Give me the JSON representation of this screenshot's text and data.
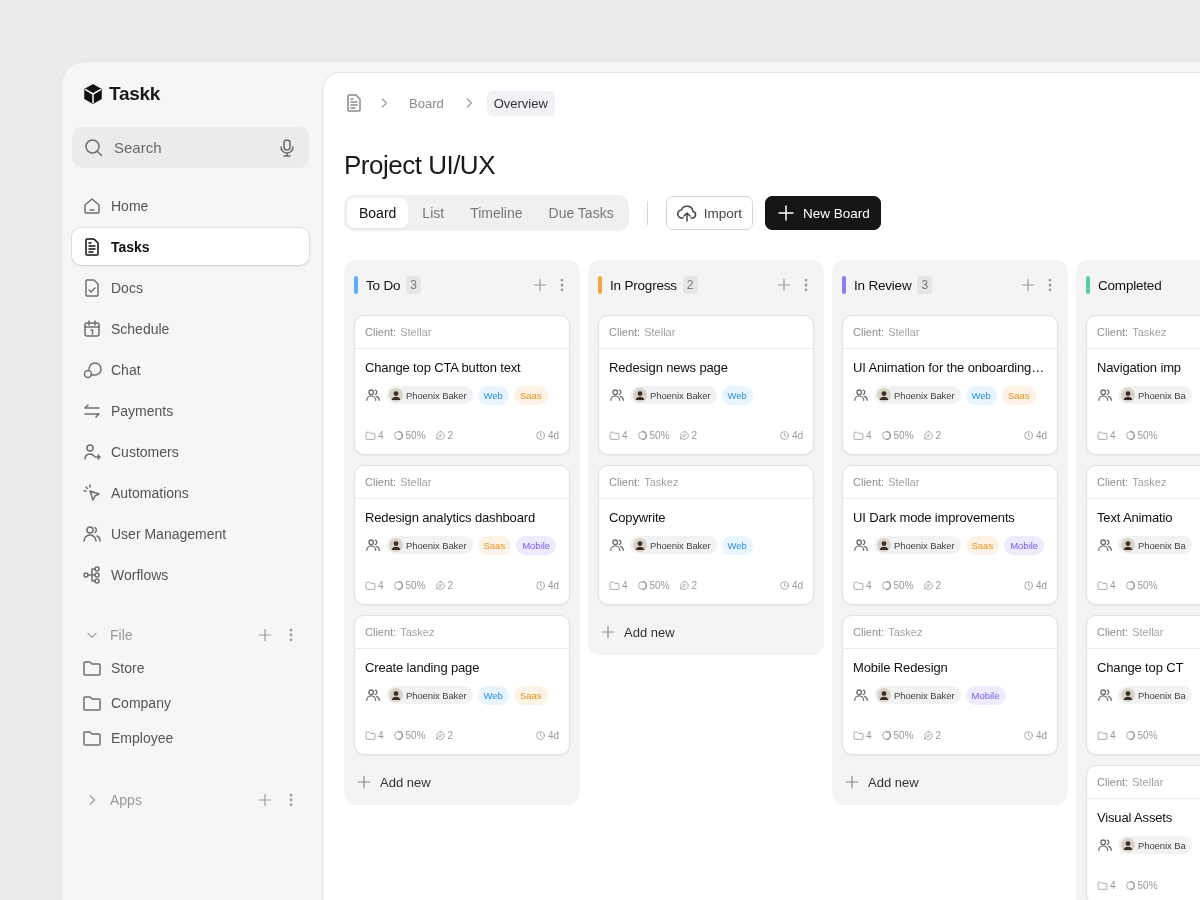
{
  "app": {
    "name": "Taskk"
  },
  "search": {
    "placeholder": "Search"
  },
  "nav": [
    {
      "label": "Home",
      "selected": false
    },
    {
      "label": "Tasks",
      "selected": true
    },
    {
      "label": "Docs",
      "selected": false
    },
    {
      "label": "Schedule",
      "selected": false
    },
    {
      "label": "Chat",
      "selected": false
    },
    {
      "label": "Payments",
      "selected": false
    },
    {
      "label": "Customers",
      "selected": false
    },
    {
      "label": "Automations",
      "selected": false
    },
    {
      "label": "User Management",
      "selected": false
    },
    {
      "label": "Worflows",
      "selected": false
    }
  ],
  "sections": [
    {
      "title": "File",
      "expanded": true,
      "items": [
        {
          "label": "Store"
        },
        {
          "label": "Company"
        },
        {
          "label": "Employee"
        }
      ]
    },
    {
      "title": "Apps",
      "expanded": false
    }
  ],
  "breadcrumb": [
    {
      "label": "Board",
      "current": false
    },
    {
      "label": "Overview",
      "current": true
    }
  ],
  "page_title": "Project UI/UX",
  "view_tabs": [
    {
      "label": "Board",
      "selected": true
    },
    {
      "label": "List",
      "selected": false
    },
    {
      "label": "Timeline",
      "selected": false
    },
    {
      "label": "Due Tasks",
      "selected": false
    }
  ],
  "actions": [
    {
      "label": "Import",
      "kind": "secondary"
    },
    {
      "label": "New Board",
      "kind": "primary"
    }
  ],
  "columns": [
    {
      "title": "To Do",
      "count": "3",
      "color": "#5aaefc",
      "add_new": "Add new",
      "cards": [
        {
          "client_label": "Client:",
          "client": "Stellar",
          "title": "Change top CTA button text",
          "assignee": "Phoenix Baker",
          "tags": [
            {
              "label": "Web",
              "kind": "web"
            },
            {
              "label": "Saas",
              "kind": "saas"
            }
          ],
          "files": "4",
          "progress": "50%",
          "comments": "2",
          "due": "4d"
        },
        {
          "client_label": "Client:",
          "client": "Stellar",
          "title": "Redesign analytics dashboard",
          "assignee": "Phoenix Baker",
          "tags": [
            {
              "label": "Saas",
              "kind": "saas"
            },
            {
              "label": "Mobile",
              "kind": "mobile"
            }
          ],
          "files": "4",
          "progress": "50%",
          "comments": "2",
          "due": "4d"
        },
        {
          "client_label": "Client:",
          "client": "Taskez",
          "title": "Create landing page",
          "assignee": "Phoenix Baker",
          "tags": [
            {
              "label": "Web",
              "kind": "web"
            },
            {
              "label": "Saas",
              "kind": "saas"
            }
          ],
          "files": "4",
          "progress": "50%",
          "comments": "2",
          "due": "4d"
        }
      ]
    },
    {
      "title": "In Progress",
      "count": "2",
      "color": "#f5a742",
      "add_new": "Add new",
      "cards": [
        {
          "client_label": "Client:",
          "client": "Stellar",
          "title": "Redesign news page",
          "assignee": "Phoenix Baker",
          "tags": [
            {
              "label": "Web",
              "kind": "web"
            }
          ],
          "files": "4",
          "progress": "50%",
          "comments": "2",
          "due": "4d"
        },
        {
          "client_label": "Client:",
          "client": "Taskez",
          "title": "Copywrite",
          "assignee": "Phoenix Baker",
          "tags": [
            {
              "label": "Web",
              "kind": "web"
            }
          ],
          "files": "4",
          "progress": "50%",
          "comments": "2",
          "due": "4d"
        }
      ]
    },
    {
      "title": "In Review",
      "count": "3",
      "color": "#8b7cf6",
      "add_new": "Add new",
      "cards": [
        {
          "client_label": "Client:",
          "client": "Stellar",
          "title": "UI Animation for the onboarding…",
          "assignee": "Phoenix Baker",
          "tags": [
            {
              "label": "Web",
              "kind": "web"
            },
            {
              "label": "Saas",
              "kind": "saas"
            }
          ],
          "files": "4",
          "progress": "50%",
          "comments": "2",
          "due": "4d"
        },
        {
          "client_label": "Client:",
          "client": "Stellar",
          "title": "UI Dark mode improvements",
          "assignee": "Phoenix Baker",
          "tags": [
            {
              "label": "Saas",
              "kind": "saas"
            },
            {
              "label": "Mobile",
              "kind": "mobile"
            }
          ],
          "files": "4",
          "progress": "50%",
          "comments": "2",
          "due": "4d"
        },
        {
          "client_label": "Client:",
          "client": "Taskez",
          "title": "Mobile Redesign",
          "assignee": "Phoenix Baker",
          "tags": [
            {
              "label": "Mobile",
              "kind": "mobile"
            }
          ],
          "files": "4",
          "progress": "50%",
          "comments": "2",
          "due": "4d"
        }
      ]
    },
    {
      "title": "Completed",
      "color": "#4fd39a",
      "cards": [
        {
          "client_label": "Client:",
          "client": "Taskez",
          "title": "Navigation imp",
          "assignee": "Phoenix Ba",
          "files": "4",
          "progress": "50%"
        },
        {
          "client_label": "Client:",
          "client": "Taskez",
          "title": "Text Animatio",
          "assignee": "Phoenix Ba",
          "files": "4",
          "progress": "50%"
        },
        {
          "client_label": "Client:",
          "client": "Stellar",
          "title": "Change top CT",
          "assignee": "Phoenix Ba",
          "files": "4",
          "progress": "50%"
        },
        {
          "client_label": "Client:",
          "client": "Stellar",
          "title": "Visual Assets",
          "assignee": "Phoenix Ba",
          "files": "4",
          "progress": "50%"
        }
      ]
    }
  ]
}
